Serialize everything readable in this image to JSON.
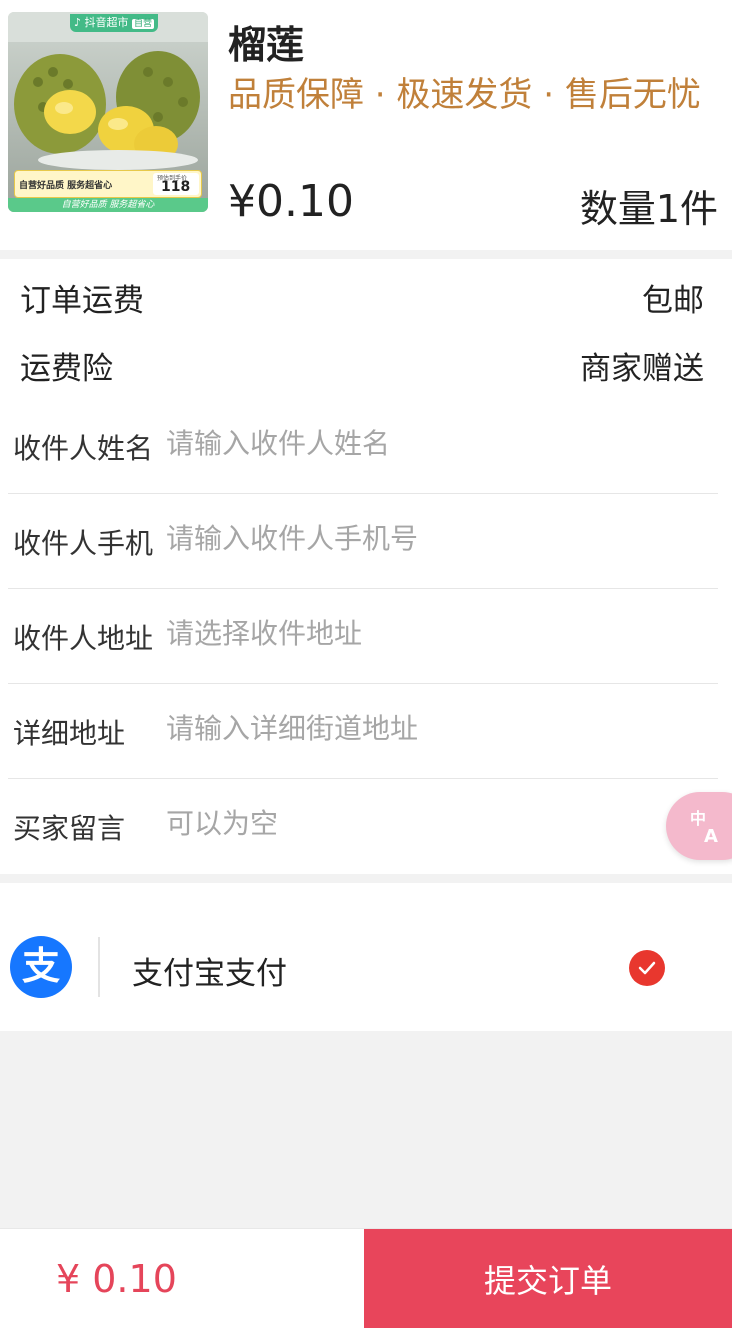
{
  "product": {
    "name": "榴莲",
    "tagline": "品质保障 · 极速发货 · 售后无忧",
    "price": "¥0.10",
    "quantity": "数量1件",
    "image": {
      "brand_badge": "抖音超市",
      "self_badge": "自营",
      "banner_text": "自营好品质 服务超省心",
      "price_label": "预估到手价",
      "price_value": "118",
      "footer_text": "自营好品质  服务超省心"
    }
  },
  "fees": {
    "shipping_label": "订单运费",
    "shipping_value": "包邮",
    "insurance_label": "运费险",
    "insurance_value": "商家赠送"
  },
  "form": {
    "name_label": "收件人姓名",
    "name_placeholder": "请输入收件人姓名",
    "phone_label": "收件人手机",
    "phone_placeholder": "请输入收件人手机号",
    "address_label": "收件人地址",
    "address_placeholder": "请选择收件地址",
    "detail_label": "详细地址",
    "detail_placeholder": "请输入详细街道地址",
    "message_label": "买家留言",
    "message_placeholder": "可以为空"
  },
  "payment": {
    "method_label": "支付宝支付",
    "logo_glyph": "支",
    "selected": true,
    "brand_color": "#1677ff",
    "check_color": "#e8372e"
  },
  "footer": {
    "total": "¥ 0.10",
    "submit_label": "提交订单",
    "accent_color": "#e8455b"
  },
  "icons": {
    "translate": "translate-icon",
    "alipay": "alipay-icon",
    "check": "check-icon"
  }
}
